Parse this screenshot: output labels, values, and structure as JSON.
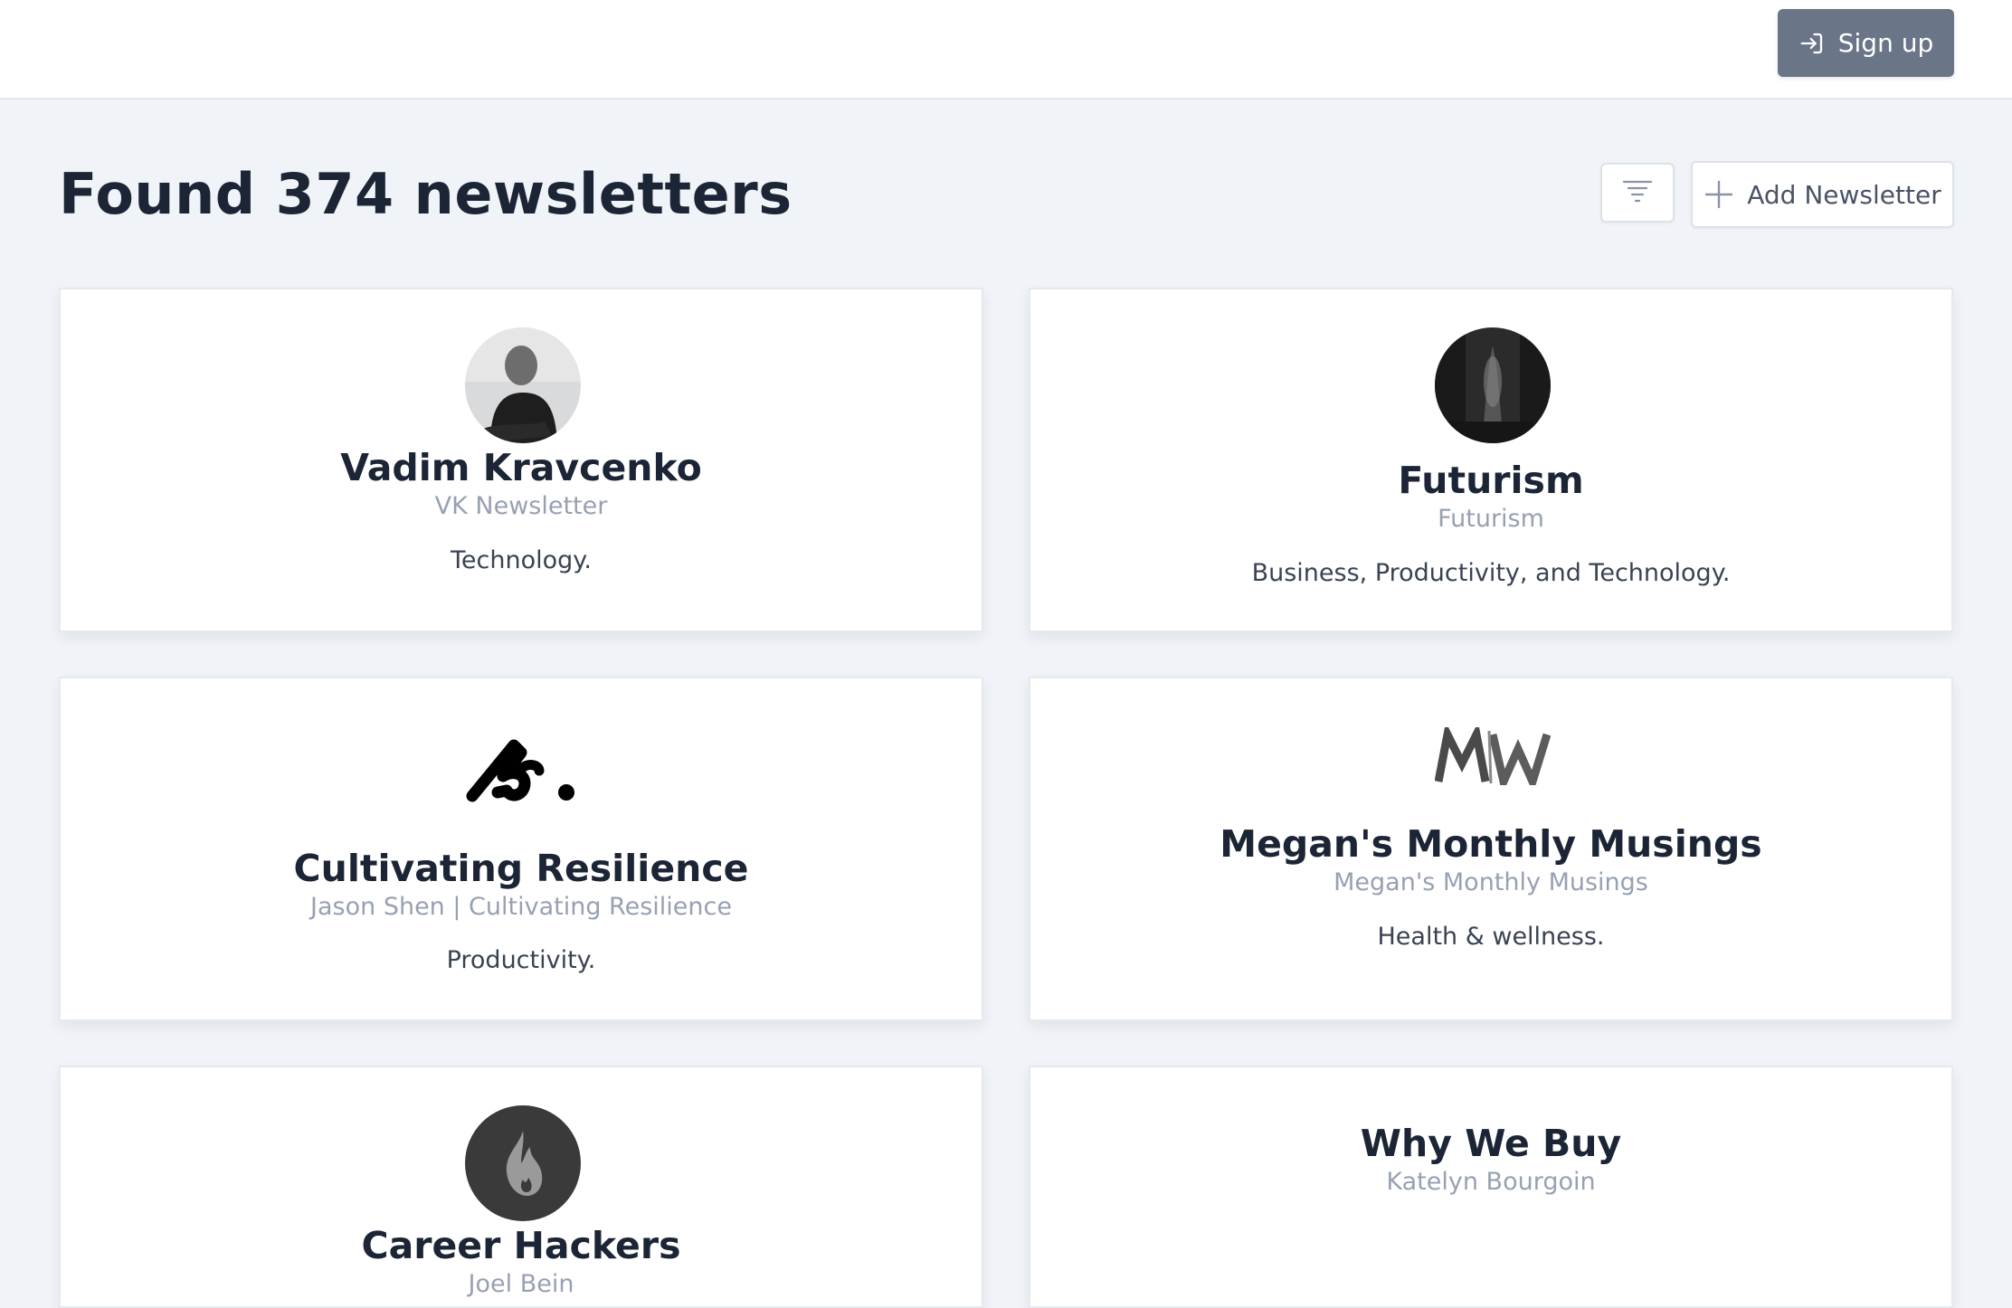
{
  "header": {
    "signup_label": "Sign up"
  },
  "main": {
    "title": "Found 374 newsletters",
    "add_label": "Add Newsletter"
  },
  "newsletters": [
    {
      "name": "Vadim Kravcenko",
      "author": "VK Newsletter",
      "categories": "Technology."
    },
    {
      "name": "Futurism",
      "author": "Futurism",
      "categories": "Business, Productivity, and Technology."
    },
    {
      "name": "Cultivating Resilience",
      "author": "Jason Shen | Cultivating Resilience",
      "categories": "Productivity."
    },
    {
      "name": "Megan's Monthly Musings",
      "author": "Megan's Monthly Musings",
      "categories": "Health & wellness.",
      "logo_text": "MW"
    },
    {
      "name": "Career Hackers",
      "author": "Joel Bein",
      "categories": ""
    },
    {
      "name": "Why We Buy",
      "author": "Katelyn Bourgoin",
      "categories": ""
    }
  ],
  "icons": {
    "signup": "sign-in-icon",
    "filter": "filter-icon",
    "add": "plus-icon"
  },
  "colors": {
    "primary_button": "#6b7588",
    "background": "#f0f3f7",
    "title_text": "#1c2535",
    "muted_text": "#97a1b3"
  }
}
